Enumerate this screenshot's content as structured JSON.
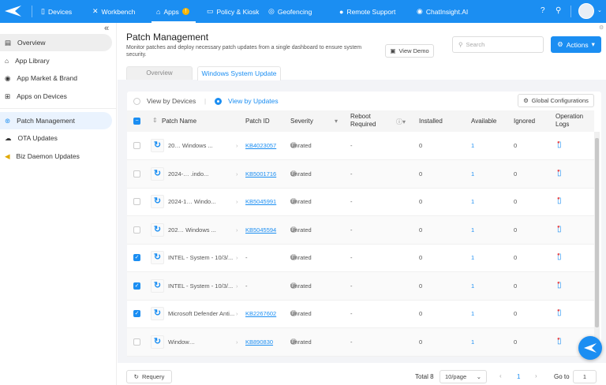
{
  "topbar": {
    "nav": [
      {
        "label": "Devices",
        "icon": "phone-icon"
      },
      {
        "label": "Workbench",
        "icon": "tools-icon"
      },
      {
        "label": "Apps",
        "icon": "bag-icon",
        "badge": "!"
      },
      {
        "label": "Policy & Kiosk",
        "icon": "folder-icon"
      },
      {
        "label": "Geofencing",
        "icon": "location-icon"
      },
      {
        "label": "Remote Support",
        "icon": "lifebuoy-icon"
      },
      {
        "label": "ChatInsight.AI",
        "icon": "ai-icon"
      }
    ],
    "active": "Apps",
    "accent": "#1b8ef2"
  },
  "sidebar": {
    "items": [
      {
        "label": "Overview",
        "icon": "list-icon"
      },
      {
        "label": "App Library",
        "icon": "bag-icon"
      },
      {
        "label": "App Market & Brand",
        "icon": "target-icon"
      },
      {
        "label": "Apps on Devices",
        "icon": "grid-icon"
      },
      {
        "label": "Patch Management",
        "icon": "patch-icon"
      },
      {
        "label": "OTA Updates",
        "icon": "cloud-upload-icon"
      },
      {
        "label": "Biz Daemon Updates",
        "icon": "daemon-icon"
      }
    ]
  },
  "page": {
    "title": "Patch Management",
    "description": "Monitor patches and deploy necessary patch updates from a single dashboard to ensure system security.",
    "view_demo": "View Demo",
    "search_placeholder": "Search",
    "actions": "Actions",
    "tabs": [
      "Overview",
      "Windows System Update"
    ],
    "active_tab": "Windows System Update"
  },
  "view": {
    "by_devices": "View by Devices",
    "by_updates": "View by Updates",
    "selected": "View by Updates",
    "global_config": "Global Configurations"
  },
  "table": {
    "headers": [
      "Patch Name",
      "Patch ID",
      "Severity",
      "Reboot Required",
      "Installed",
      "Available",
      "Ignored",
      "Operation Logs"
    ],
    "rows": [
      {
        "checked": false,
        "name": "20… Windows ...",
        "patch_id": "KB4023057",
        "severity": "Unrated",
        "reboot": "-",
        "installed": "0",
        "available": "1",
        "ignored": "0"
      },
      {
        "checked": false,
        "name": "2024-… .indo...",
        "patch_id": "KB5001716",
        "severity": "Unrated",
        "reboot": "-",
        "installed": "0",
        "available": "1",
        "ignored": "0"
      },
      {
        "checked": false,
        "name": "2024-1… Windo...",
        "patch_id": "KB5045991",
        "severity": "Unrated",
        "reboot": "-",
        "installed": "0",
        "available": "1",
        "ignored": "0"
      },
      {
        "checked": false,
        "name": "202… Windows ...",
        "patch_id": "KB5045594",
        "severity": "Unrated",
        "reboot": "-",
        "installed": "0",
        "available": "1",
        "ignored": "0"
      },
      {
        "checked": true,
        "name": "INTEL - System - 10/3/...",
        "patch_id": "-",
        "severity": "Unrated",
        "reboot": "-",
        "installed": "0",
        "available": "1",
        "ignored": "0"
      },
      {
        "checked": true,
        "name": "INTEL - System - 10/3/...",
        "patch_id": "-",
        "severity": "Unrated",
        "reboot": "-",
        "installed": "0",
        "available": "1",
        "ignored": "0"
      },
      {
        "checked": true,
        "name": "Microsoft Defender Anti...",
        "patch_id": "KB2267602",
        "severity": "Unrated",
        "reboot": "-",
        "installed": "0",
        "available": "1",
        "ignored": "0"
      },
      {
        "checked": false,
        "name": "Window…",
        "patch_id": "KB890830",
        "severity": "Unrated",
        "reboot": "-",
        "installed": "0",
        "available": "1",
        "ignored": "0"
      }
    ]
  },
  "footer": {
    "requery": "Requery",
    "total": "Total 8",
    "page_size": "10/page",
    "current_page": "1",
    "goto_label": "Go to",
    "goto_value": "1"
  }
}
